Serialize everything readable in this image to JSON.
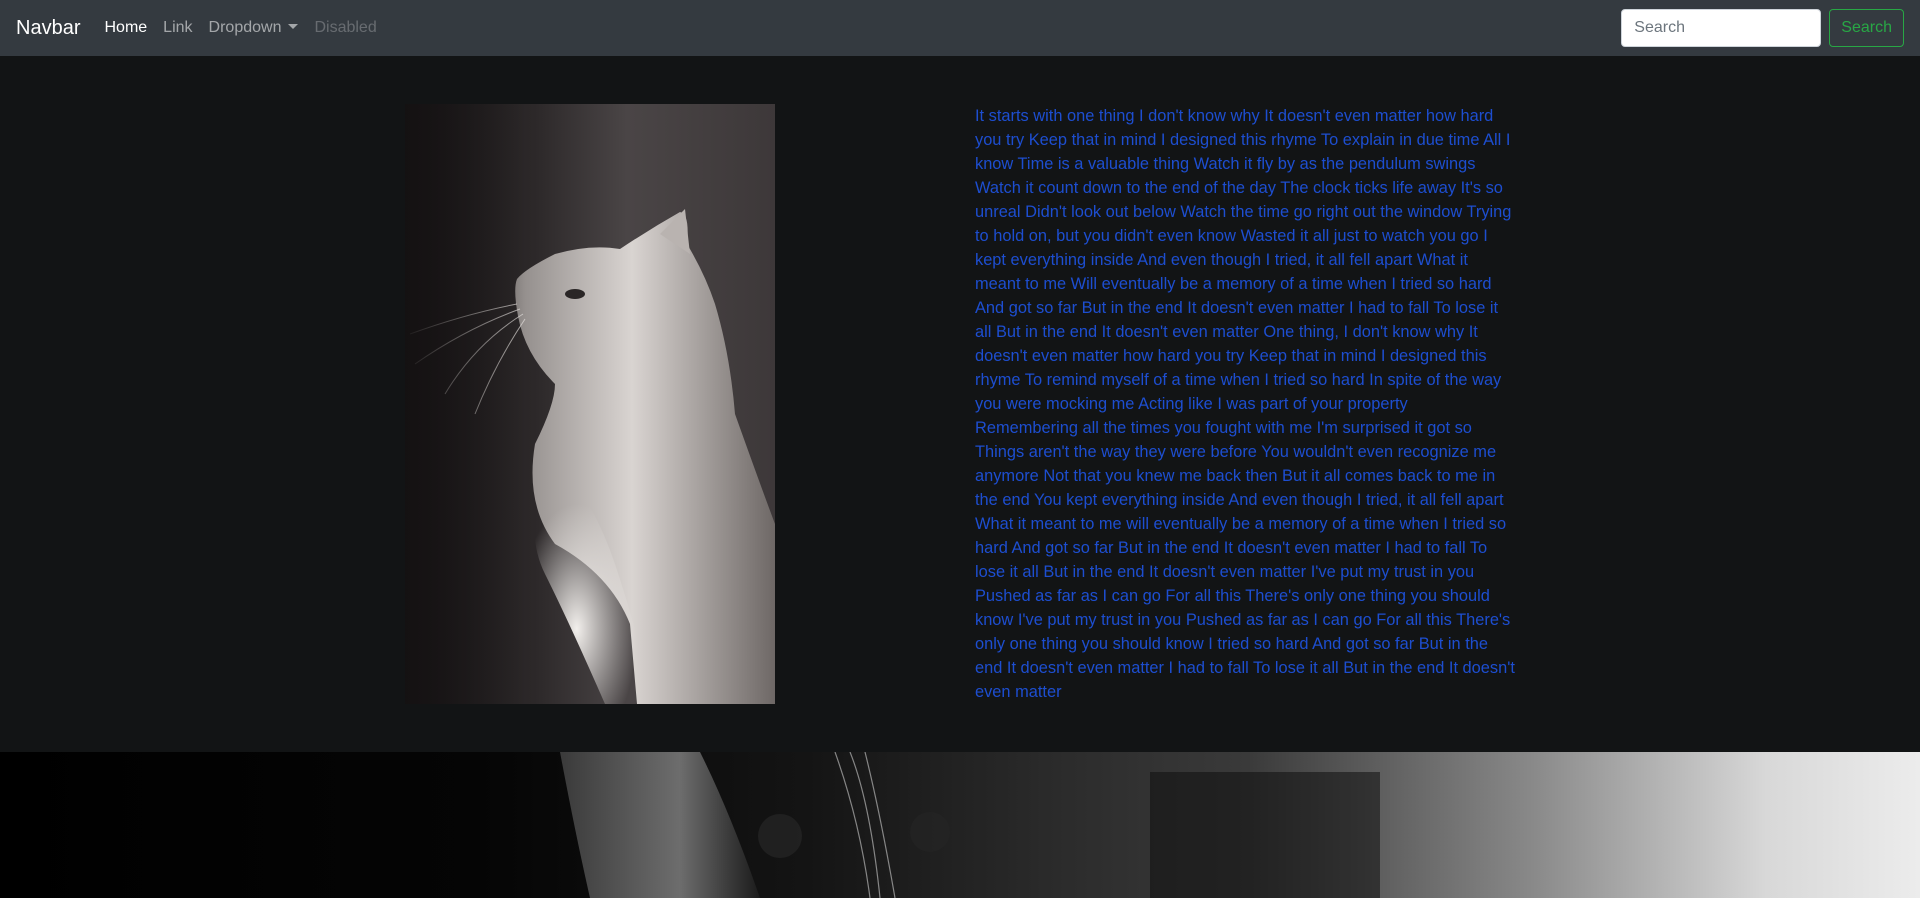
{
  "navbar": {
    "brand": "Navbar",
    "links": [
      {
        "label": "Home",
        "state": "active"
      },
      {
        "label": "Link",
        "state": "normal"
      },
      {
        "label": "Dropdown",
        "state": "normal"
      },
      {
        "label": "Disabled",
        "state": "disabled"
      }
    ],
    "search": {
      "placeholder": "Search",
      "value": "",
      "button_label": "Search"
    }
  },
  "main": {
    "image": {
      "icon": "cat-profile-photo"
    },
    "lyrics": "It starts with one thing I don't know why It doesn't even matter how hard you try Keep that in mind I designed this rhyme To explain in due time All I know Time is a valuable thing Watch it fly by as the pendulum swings Watch it count down to the end of the day The clock ticks life away It's so unreal Didn't look out below Watch the time go right out the window Trying to hold on, but you didn't even know Wasted it all just to watch you go I kept everything inside And even though I tried, it all fell apart What it meant to me Will eventually be a memory of a time when I tried so hard And got so far But in the end It doesn't even matter I had to fall To lose it all But in the end It doesn't even matter One thing, I don't know why It doesn't even matter how hard you try Keep that in mind I designed this rhyme To remind myself of a time when I tried so hard In spite of the way you were mocking me Acting like I was part of your property Remembering all the times you fought with me I'm surprised it got so Things aren't the way they were before You wouldn't even recognize me anymore Not that you knew me back then But it all comes back to me in the end You kept everything inside And even though I tried, it all fell apart What it meant to me will eventually be a memory of a time when I tried so hard And got so far But in the end It doesn't even matter I had to fall To lose it all But in the end It doesn't even matter I've put my trust in you Pushed as far as I can go For all this There's only one thing you should know I've put my trust in you Pushed as far as I can go For all this There's only one thing you should know I tried so hard And got so far But in the end It doesn't even matter I had to fall To lose it all But in the end It doesn't even matter"
  },
  "banner": {
    "icon": "cat-closeup-banner-photo"
  },
  "colors": {
    "navbar_bg": "#343a40",
    "page_bg": "#121415",
    "lyrics_text": "#1d4ed0",
    "search_accent": "#28a745"
  }
}
